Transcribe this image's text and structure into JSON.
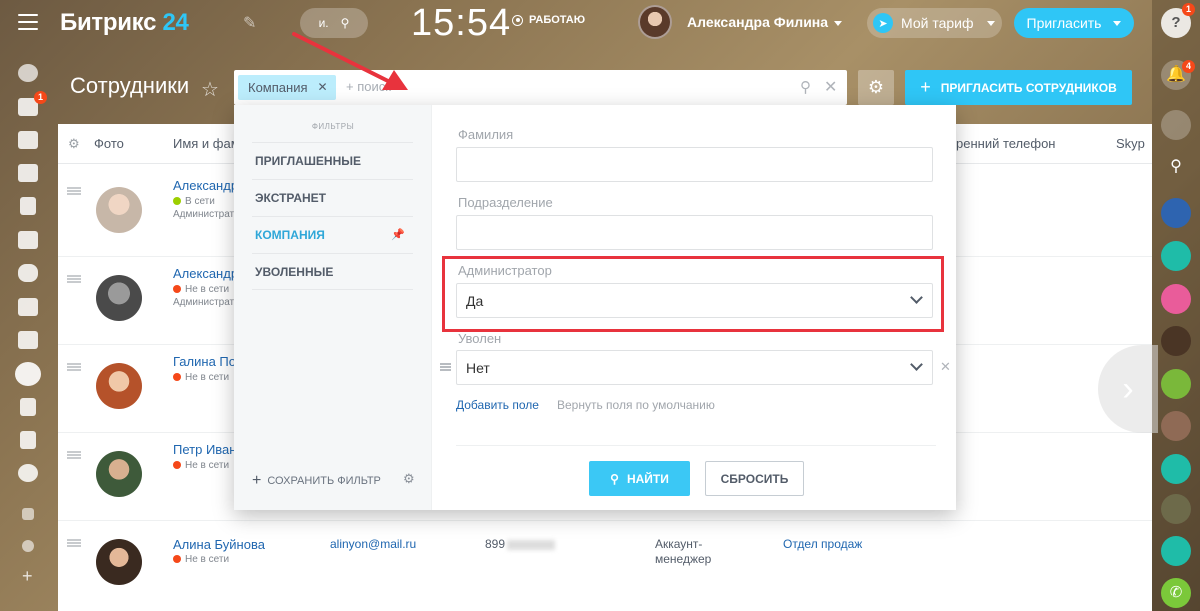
{
  "header": {
    "logo_main": "Битрикс",
    "logo_num": "24",
    "search_label": "и.",
    "clock": "15:54",
    "work_status": "РАБОТАЮ",
    "user_name": "Александра Филина",
    "tariff_label": "Мой тариф",
    "invite_label": "Пригласить"
  },
  "left_sidebar": {
    "badges": [
      "1"
    ]
  },
  "right_sidebar": {
    "notification_badge": "1",
    "bell_badge": "4"
  },
  "page": {
    "title": "Сотрудники",
    "filter_chip": "Компания",
    "search_placeholder": "+ поиск",
    "invite_button": "ПРИГЛАСИТЬ СОТРУДНИКОВ"
  },
  "grid": {
    "columns": [
      "Фото",
      "Имя и фам",
      "ренний телефон",
      "Skyp"
    ],
    "rows": [
      {
        "name": "Александр",
        "status": "В сети",
        "status_color": "#9dcf00",
        "role": "Администрат"
      },
      {
        "name": "Александр",
        "status": "Не в сети",
        "status_color": "#f54819",
        "role": "Администрат"
      },
      {
        "name": "Галина Пол",
        "status": "Не в сети",
        "status_color": "#f54819",
        "role": ""
      },
      {
        "name": "Петр Иван",
        "status": "Не в сети",
        "status_color": "#f54819",
        "role": ""
      },
      {
        "name": "Алина Буйнова",
        "status": "Не в сети",
        "status_color": "#f54819",
        "role": "",
        "email": "alinyon@mail.ru",
        "phone": "899",
        "position_1": "Аккаунт-",
        "position_2": "менеджер",
        "department": "Отдел продаж"
      }
    ]
  },
  "filter_popup": {
    "presets_title": "ФИЛЬТРЫ",
    "presets": [
      "ПРИГЛАШЕННЫЕ",
      "ЭКСТРАНЕТ",
      "КОМПАНИЯ",
      "УВОЛЕННЫЕ"
    ],
    "active_preset": "КОМПАНИЯ",
    "save_filter": "СОХРАНИТЬ ФИЛЬТР",
    "fields": {
      "lastname_label": "Фамилия",
      "department_label": "Подразделение",
      "admin_label": "Администратор",
      "admin_value": "Да",
      "fired_label": "Уволен",
      "fired_value": "Нет"
    },
    "add_field": "Добавить поле",
    "restore_fields": "Вернуть поля по умолчанию",
    "find_button": "НАЙТИ",
    "reset_button": "СБРОСИТЬ"
  },
  "colors": {
    "accent": "#2fc6f6",
    "link": "#2067b0",
    "online": "#9dcf00",
    "offline": "#f54819",
    "highlight": "#e8333d"
  }
}
